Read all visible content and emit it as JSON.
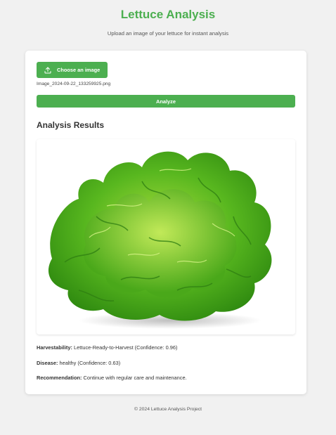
{
  "header": {
    "title": "Lettuce Analysis",
    "subtitle": "Upload an image of your lettuce for instant analysis"
  },
  "upload": {
    "choose_label": "Choose an image",
    "file_name": "Image_2024-09-22_133259925.png",
    "analyze_label": "Analyze"
  },
  "results": {
    "heading": "Analysis Results",
    "image_alt": "lettuce photo",
    "harvestability_label": "Harvestability:",
    "harvestability_value": "Lettuce-Ready-to-Harvest (Confidence: 0.96)",
    "disease_label": "Disease:",
    "disease_value": "healthy (Confidence: 0.63)",
    "recommendation_label": "Recommendation:",
    "recommendation_value": "Continue with regular care and maintenance."
  },
  "footer": {
    "text": "© 2024 Lettuce Analysis Project"
  },
  "colors": {
    "accent": "#4caf50",
    "background": "#f1f1f1",
    "card": "#ffffff"
  },
  "icons": {
    "upload": "upload-icon"
  }
}
